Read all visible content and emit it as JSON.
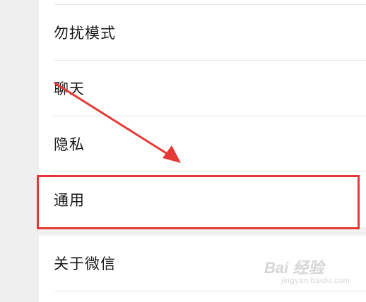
{
  "settings": {
    "items": [
      {
        "label": "勿扰模式"
      },
      {
        "label": "聊天"
      },
      {
        "label": "隐私"
      },
      {
        "label": "通用"
      },
      {
        "label": "关于微信"
      }
    ]
  },
  "annotation": {
    "highlight_color": "#e53935",
    "arrow_color": "#e53935",
    "highlighted_item": "通用"
  },
  "watermark": {
    "logo": "Bai 经验",
    "url": "jingyan.baidu.com"
  }
}
